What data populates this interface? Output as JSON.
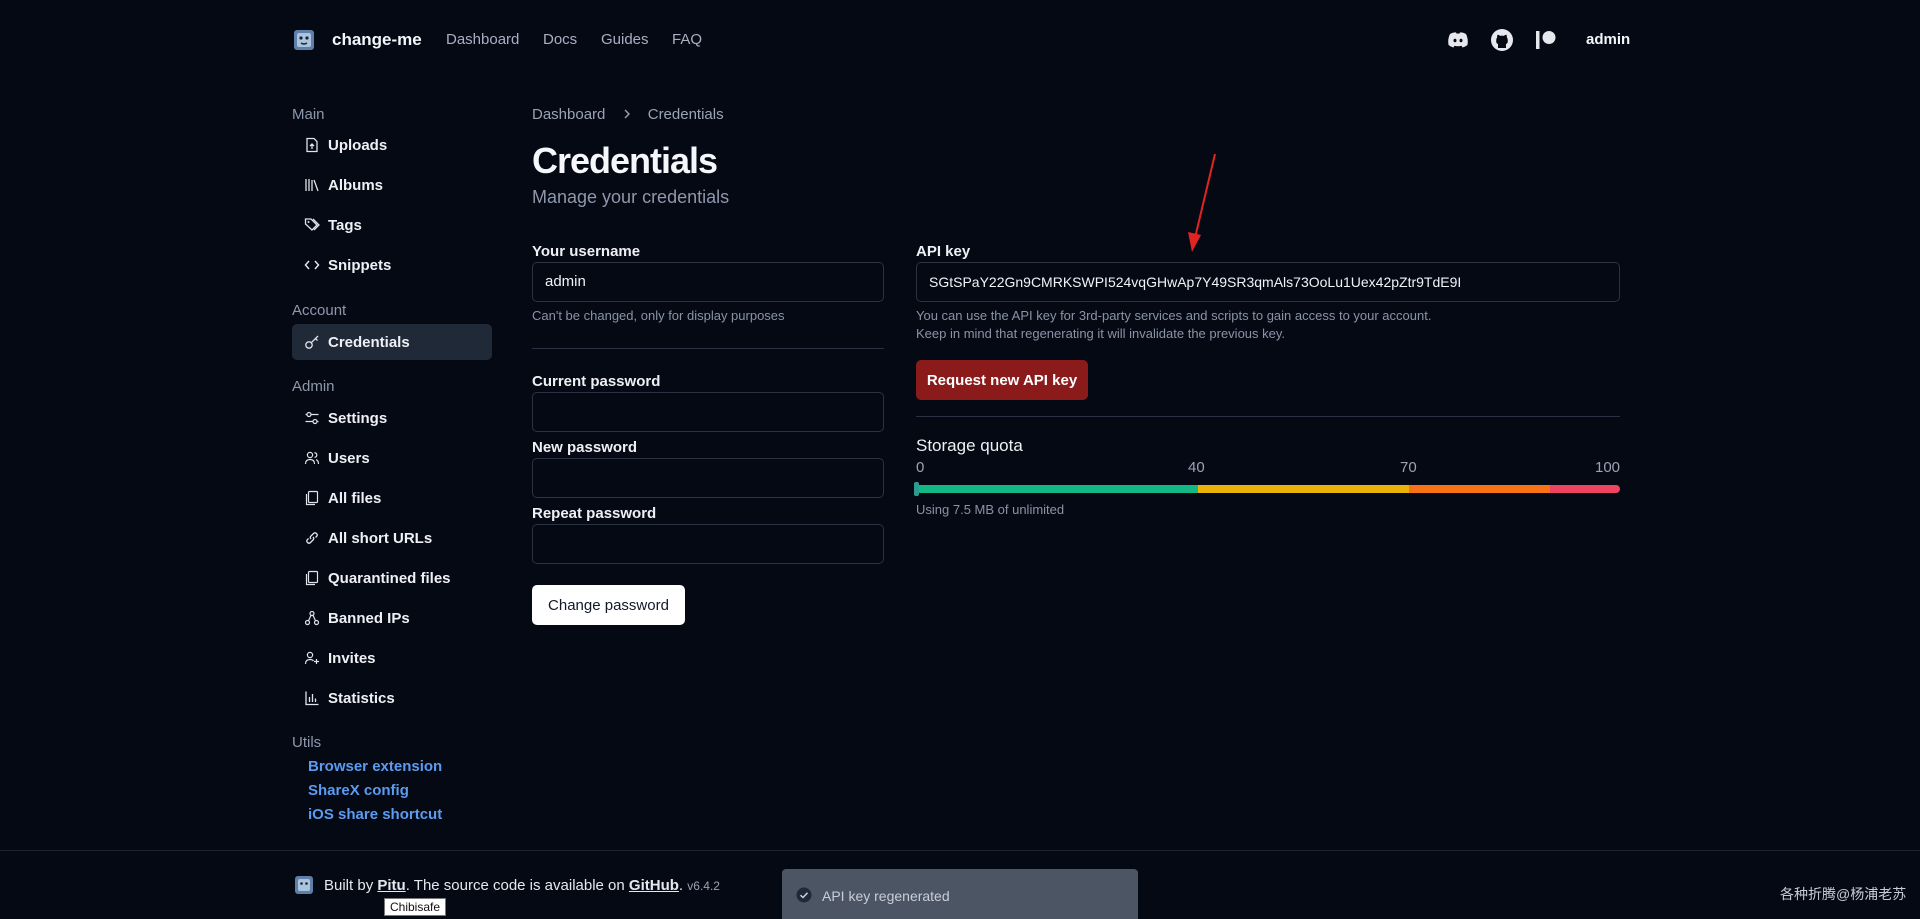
{
  "nav": {
    "brand": "change-me",
    "links": [
      "Dashboard",
      "Docs",
      "Guides",
      "FAQ"
    ],
    "icons": [
      "discord-icon",
      "github-icon",
      "patreon-icon"
    ],
    "user": "admin"
  },
  "sidebar": {
    "sections": [
      {
        "label": "Main",
        "items": [
          "Uploads",
          "Albums",
          "Tags",
          "Snippets"
        ]
      },
      {
        "label": "Account",
        "items": [
          "Credentials"
        ]
      },
      {
        "label": "Admin",
        "items": [
          "Settings",
          "Users",
          "All files",
          "All short URLs",
          "Quarantined files",
          "Banned IPs",
          "Invites",
          "Statistics"
        ]
      },
      {
        "label": "Utils",
        "links": [
          "Browser extension",
          "ShareX config",
          "iOS share shortcut"
        ]
      }
    ],
    "active_item": "Credentials"
  },
  "breadcrumb": [
    "Dashboard",
    "Credentials"
  ],
  "page": {
    "title": "Credentials",
    "subtitle": "Manage your credentials"
  },
  "username": {
    "label": "Your username",
    "value": "admin",
    "help": "Can't be changed, only for display purposes"
  },
  "password": {
    "current_label": "Current password",
    "new_label": "New password",
    "repeat_label": "Repeat password",
    "button": "Change password"
  },
  "api": {
    "label": "API key",
    "value": "SGtSPaY22Gn9CMRKSWPI524vqGHwAp7Y49SR3qmAls73OoLu1Uex42pZtr9TdE9I",
    "help_line1": "You can use the API key for 3rd-party services and scripts to gain access to your account.",
    "help_line2": "Keep in mind that regenerating it will invalidate the previous key.",
    "button": "Request new API key"
  },
  "quota": {
    "title": "Storage quota",
    "ticks": [
      "0",
      "40",
      "70",
      "100"
    ],
    "used_fraction": 0,
    "text": "Using 7.5 MB of unlimited",
    "colors": {
      "green": "#14b885",
      "yellow": "#eab308",
      "orange": "#f97316",
      "red": "#ef4461"
    }
  },
  "footer": {
    "prefix": "Built by",
    "author": "Pitu",
    "middle": ". The source code is available on",
    "repo": "GitHub",
    "suffix": ".",
    "version": "v6.4.2",
    "tooltip": "Chibisafe"
  },
  "toast": {
    "message": "API key regenerated"
  },
  "watermark": "各种折腾@杨浦老苏",
  "colors": {
    "background": "#050914",
    "danger": "#8b1a1a",
    "link": "#5b9bf0"
  }
}
